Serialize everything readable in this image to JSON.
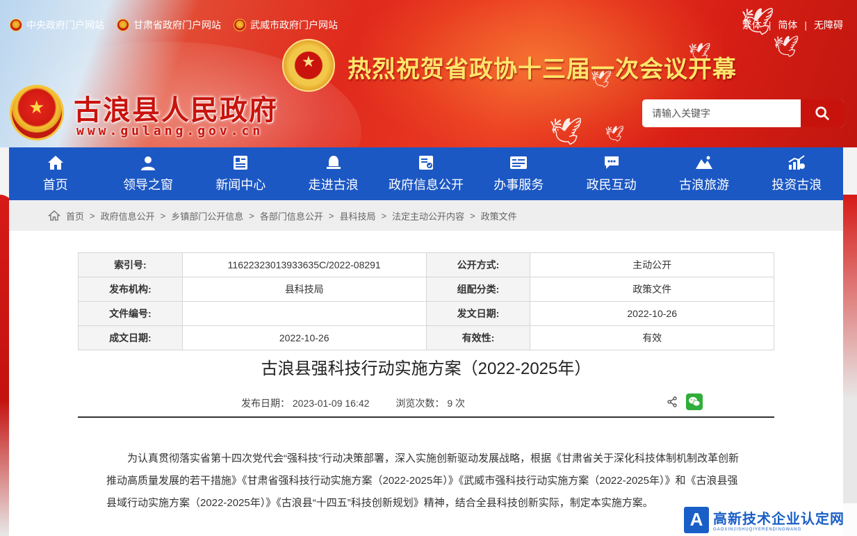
{
  "header": {
    "top_links": [
      {
        "label": "中央政府门户网站"
      },
      {
        "label": "甘肃省政府门户网站"
      },
      {
        "label": "武威市政府门户网站"
      }
    ],
    "lang": {
      "traditional": "繁体",
      "simplified": "简体",
      "accessible": "无障碍",
      "sep": "|"
    },
    "site_title": "古浪县人民政府",
    "site_url": "www.gulang.gov.cn",
    "headline": "热烈祝贺省政协十三届一次会议开幕",
    "search": {
      "placeholder": "请输入关键字"
    }
  },
  "nav": {
    "items": [
      {
        "label": "首页",
        "icon": "home-icon"
      },
      {
        "label": "领导之窗",
        "icon": "person-icon"
      },
      {
        "label": "新闻中心",
        "icon": "news-icon"
      },
      {
        "label": "走进古浪",
        "icon": "bell-icon"
      },
      {
        "label": "政府信息公开",
        "icon": "document-icon"
      },
      {
        "label": "办事服务",
        "icon": "card-icon"
      },
      {
        "label": "政民互动",
        "icon": "chat-icon"
      },
      {
        "label": "古浪旅游",
        "icon": "mountain-icon"
      },
      {
        "label": "投资古浪",
        "icon": "chart-icon"
      }
    ]
  },
  "breadcrumb": {
    "items": [
      "首页",
      "政府信息公开",
      "乡镇部门公开信息",
      "各部门信息公开",
      "县科技局",
      "法定主动公开内容",
      "政策文件"
    ],
    "sep": ">"
  },
  "meta": {
    "rows": [
      {
        "k1": "索引号:",
        "v1": "11622323013933635C/2022-08291",
        "k2": "公开方式:",
        "v2": "主动公开"
      },
      {
        "k1": "发布机构:",
        "v1": "县科技局",
        "k2": "组配分类:",
        "v2": "政策文件"
      },
      {
        "k1": "文件编号:",
        "v1": "",
        "k2": "发文日期:",
        "v2": "2022-10-26"
      },
      {
        "k1": "成文日期:",
        "v1": "2022-10-26",
        "k2": "有效性:",
        "v2": "有效"
      }
    ]
  },
  "article": {
    "title": "古浪县强科技行动实施方案（2022-2025年）",
    "publish_label": "发布日期：",
    "publish_date": "2023-01-09 16:42",
    "views_label": "浏览次数：",
    "views": "9 次",
    "body": "为认真贯彻落实省第十四次党代会“强科技”行动决策部署，深入实施创新驱动发展战略，根据《甘肃省关于深化科技体制机制改革创新推动高质量发展的若干措施》《甘肃省强科技行动实施方案（2022-2025年）》《武威市强科技行动实施方案（2022-2025年）》和《古浪县强县域行动实施方案（2022-2025年）》《古浪县“十四五”科技创新规划》精神，结合全县科技创新实际，制定本实施方案。"
  },
  "watermark": {
    "logo": "A",
    "main": "高新技术企业认定网",
    "sub": "GAOXINJISHUQIYERENDINGWANG"
  },
  "colors": {
    "nav_blue": "#1c58c4",
    "brand_red": "#c8130d",
    "headline_gold": "#ffe56b"
  }
}
